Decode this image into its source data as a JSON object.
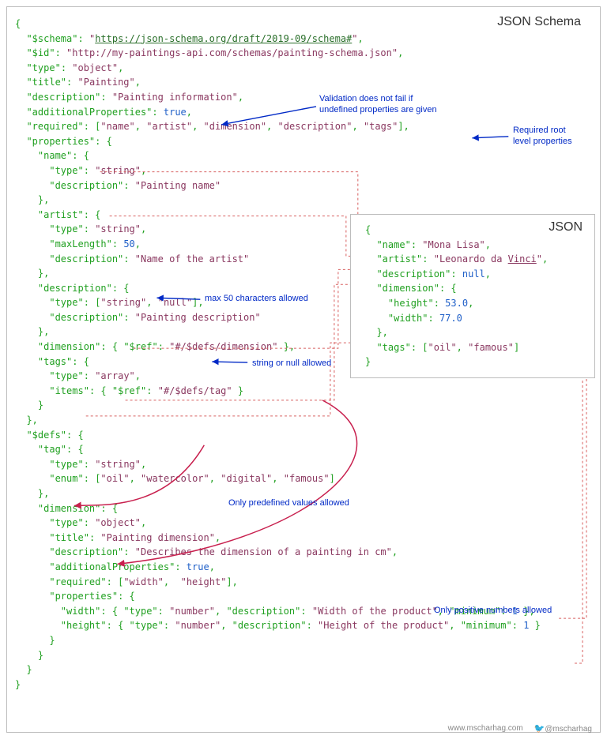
{
  "labels": {
    "schema": "JSON Schema",
    "json": "JSON"
  },
  "annotations": {
    "addl": "Validation does not fail if\nundefined properties are given",
    "required": "Required root\nlevel properties",
    "maxlen": "max 50 characters allowed",
    "strnull": "string or null allowed",
    "enum": "Only predefined values allowed",
    "positive": "Only positive numbers allowed"
  },
  "schema": {
    "schema_url": "https://json-schema.org/draft/2019-09/schema#",
    "id_url": "http://my-paintings-api.com/schemas/painting-schema.json",
    "type": "object",
    "title": "Painting",
    "description": "Painting information",
    "additionalProperties": "true",
    "required": [
      "name",
      "artist",
      "dimension",
      "description",
      "tags"
    ],
    "properties": {
      "name": {
        "type": "string",
        "description": "Painting name"
      },
      "artist": {
        "type": "string",
        "maxLength": "50",
        "description": "Name of the artist"
      },
      "description": {
        "type": [
          "string",
          "null"
        ],
        "description": "Painting description"
      },
      "dimension_ref": "#/$defs/dimension",
      "tags": {
        "type": "array",
        "items_ref": "#/$defs/tag"
      }
    },
    "defs": {
      "tag": {
        "type": "string",
        "enum": [
          "oil",
          "watercolor",
          "digital",
          "famous"
        ]
      },
      "dimension": {
        "type": "object",
        "title": "Painting dimension",
        "description": "Describes the dimension of a painting in cm",
        "additionalProperties": "true",
        "required": [
          "width",
          "height"
        ],
        "width": {
          "type": "number",
          "description": "Width of the product",
          "minimum": "1"
        },
        "height": {
          "type": "number",
          "description": "Height of the product",
          "minimum": "1"
        }
      }
    }
  },
  "instance": {
    "name": "Mona Lisa",
    "artist": "Leonardo da Vinci",
    "artist_ul": "Vinci",
    "description": "null",
    "dimension": {
      "height": "53.0",
      "width": "77.0"
    },
    "tags": [
      "oil",
      "famous"
    ]
  },
  "footer": {
    "site": "www.mscharhag.com",
    "handle": "@mscharhag"
  }
}
